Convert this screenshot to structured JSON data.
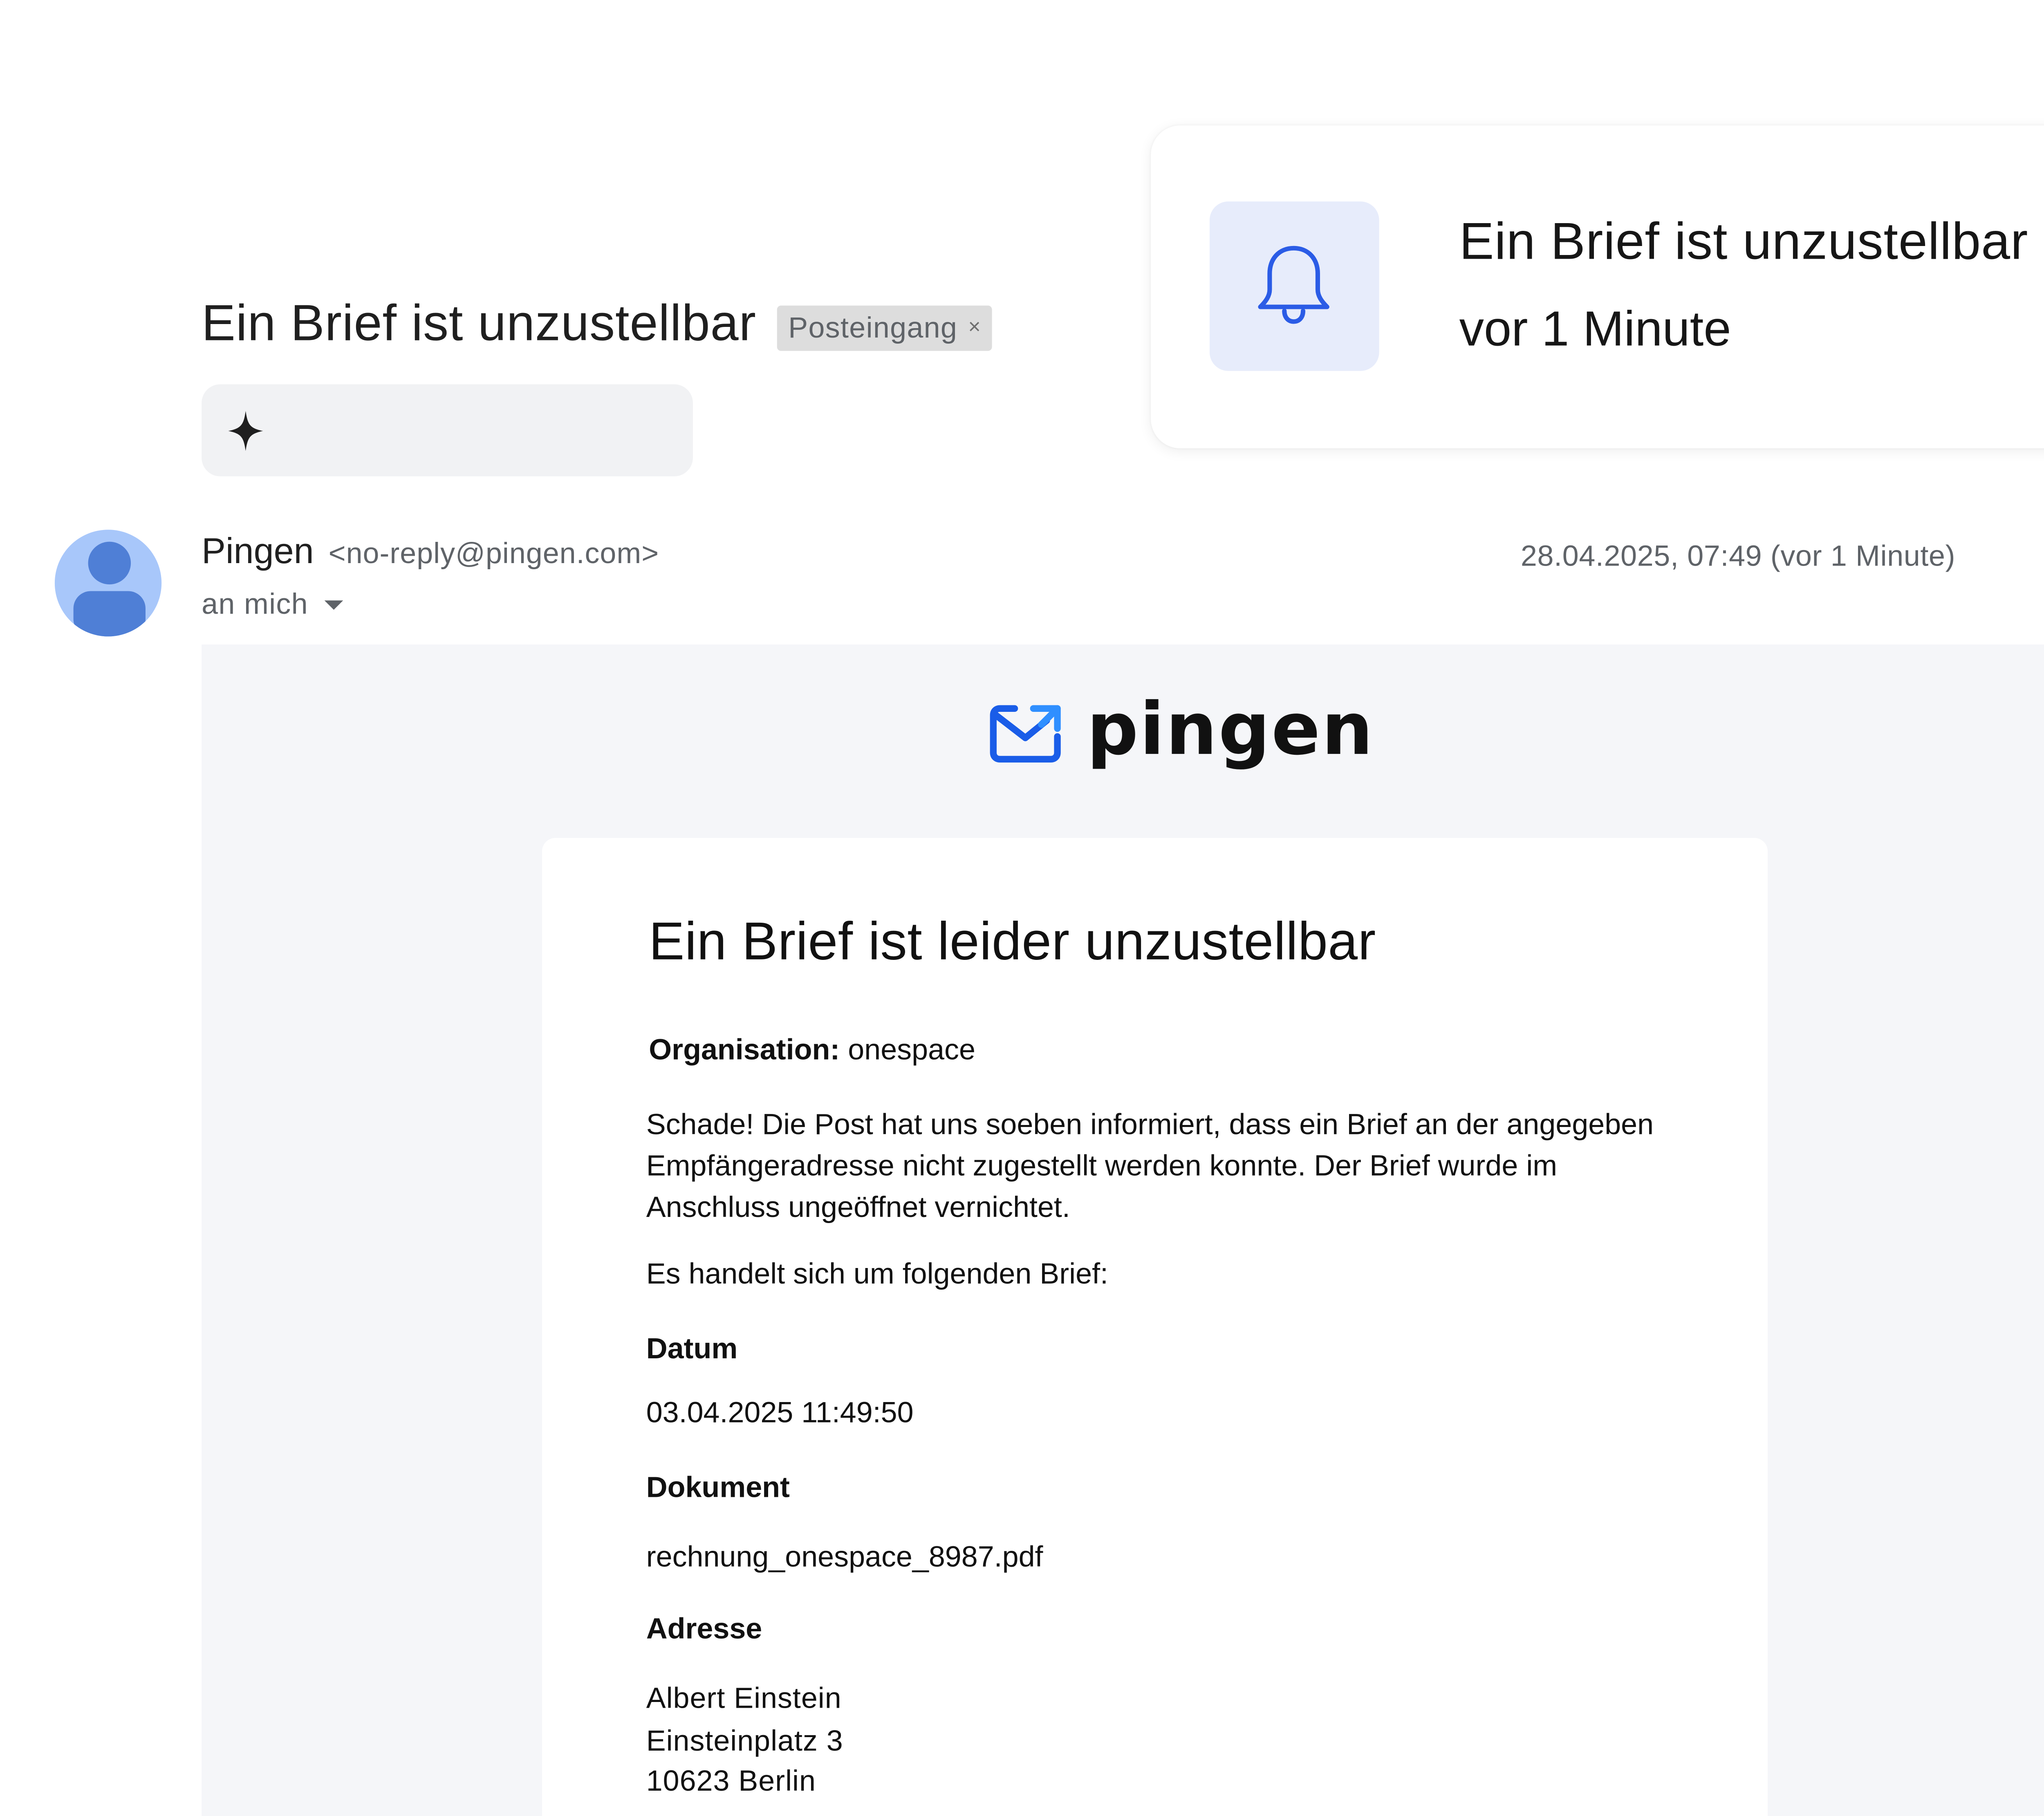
{
  "subject": {
    "title": "Ein Brief ist unzustellbar",
    "label": "Posteingang",
    "label_close": "×"
  },
  "summary": {
    "icon": "sparkle-icon"
  },
  "notification": {
    "icon": "bell-icon",
    "title": "Ein Brief ist unzustellbar",
    "time": "vor 1 Minute"
  },
  "message": {
    "sender_name": "Pingen",
    "sender_email": "<no-reply@pingen.com>",
    "recipient": "an mich",
    "date": "28.04.2025, 07:49 (vor 1 Minute)",
    "star": "☆"
  },
  "brand": {
    "name": "pingen",
    "accent": "#1a5de8"
  },
  "content": {
    "title": "Ein Brief ist leider unzustellbar",
    "org_label": "Organisation:",
    "org_value": "onespace",
    "paragraph": "Schade! Die Post hat uns soeben informiert, dass ein Brief an der angegeben Empfängeradresse nicht zugestellt werden konnte. Der Brief wurde im Anschluss ungeöffnet vernichtet.",
    "intro": "Es handelt sich um folgenden Brief:",
    "date_label": "Datum",
    "date_value": "03.04.2025 11:49:50",
    "document_label": "Dokument",
    "document_value": "rechnung_onespace_8987.pdf",
    "address_label": "Adresse",
    "address_lines": [
      "Albert Einstein",
      "Einsteinplatz 3",
      "10623 Berlin"
    ]
  },
  "colors": {
    "avatar_bg": "#a8c7fa",
    "avatar_fg": "#4f7fd6",
    "bell_bg": "#e7ecfb",
    "bell_stroke": "#2b5ce6",
    "mail_bg": "#f5f6f9"
  }
}
